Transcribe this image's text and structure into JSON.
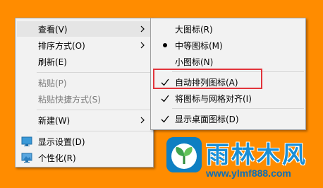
{
  "main_menu": {
    "items": [
      {
        "label": "查看(V)"
      },
      {
        "label": "排序方式(O)"
      },
      {
        "label": "刷新(E)"
      },
      {
        "label": "粘贴(P)"
      },
      {
        "label": "粘贴快捷方式(S)"
      },
      {
        "label": "新建(W)"
      },
      {
        "label": "显示设置(D)"
      },
      {
        "label": "个性化(R)"
      }
    ]
  },
  "sub_menu": {
    "items": [
      {
        "label": "大图标(R)"
      },
      {
        "label": "中等图标(M)"
      },
      {
        "label": "小图标(N)"
      },
      {
        "label": "自动排列图标(A)"
      },
      {
        "label": "将图标与网格对齐(I)"
      },
      {
        "label": "显示桌面图标(D)"
      }
    ]
  },
  "watermark": {
    "title": "雨林木风",
    "url": "www.ylmf888.com"
  },
  "colors": {
    "desktop": "#ff8c00",
    "menu_bg": "#f2f2f2",
    "highlight": "#e5e5e5",
    "callout": "#e2343b",
    "brand": "#1a8fd6"
  },
  "icons": [
    "chevron-right-icon",
    "check-icon",
    "radio-dot-icon",
    "display-settings-icon",
    "personalize-icon"
  ]
}
